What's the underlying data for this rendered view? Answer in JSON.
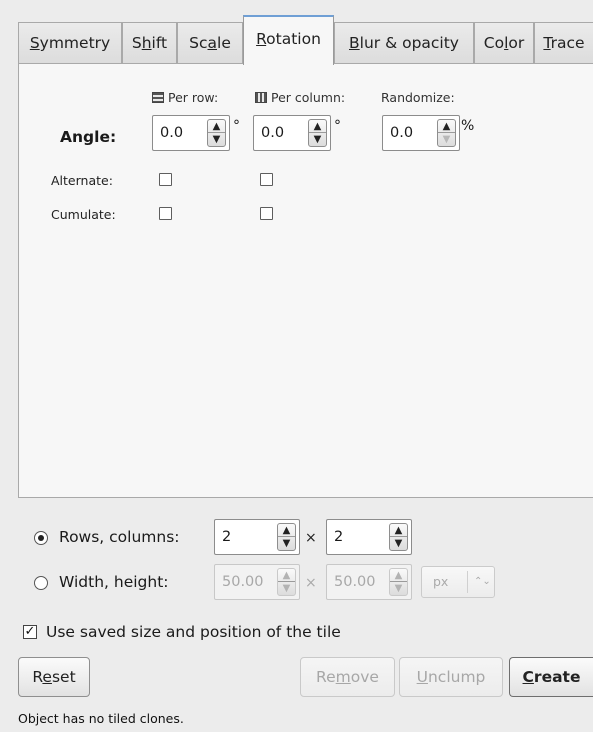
{
  "tabs": [
    {
      "pre": "",
      "key": "S",
      "post": "ymmetry"
    },
    {
      "pre": "S",
      "key": "h",
      "post": "ift"
    },
    {
      "pre": "Sc",
      "key": "a",
      "post": "le"
    },
    {
      "pre": "",
      "key": "R",
      "post": "otation"
    },
    {
      "pre": "",
      "key": "B",
      "post": "lur & opacity"
    },
    {
      "pre": "Co",
      "key": "l",
      "post": "or"
    },
    {
      "pre": "",
      "key": "T",
      "post": "race"
    }
  ],
  "rotation": {
    "col_per_row": "Per row:",
    "col_per_column": "Per column:",
    "col_randomize": "Randomize:",
    "angle_label": "Angle:",
    "angle_per_row": "0.0",
    "angle_per_column": "0.0",
    "angle_randomize": "0.0",
    "degree_unit": "°",
    "percent_unit": "%",
    "alternate_label": "Alternate:",
    "cumulate_label": "Cumulate:"
  },
  "tiling": {
    "rows_columns_label": "Rows, columns:",
    "rows": "2",
    "columns": "2",
    "times": "×",
    "width_height_label": "Width, height:",
    "width": "50.00",
    "height": "50.00",
    "unit": "px"
  },
  "use_saved_label": "Use saved size and position of the tile",
  "check_glyph": "✓",
  "buttons": {
    "reset": {
      "pre": "R",
      "key": "e",
      "post": "set"
    },
    "remove": {
      "pre": "Re",
      "key": "m",
      "post": "ove"
    },
    "unclump": {
      "pre": "",
      "key": "U",
      "post": "nclump"
    },
    "create": {
      "pre": "",
      "key": "C",
      "post": "reate"
    }
  },
  "status": "Object has no tiled clones.",
  "icons": {
    "per_row": "rows-icon",
    "per_column": "columns-icon",
    "spin_up": "▲",
    "spin_down": "▼",
    "dropdown": "⌃⌄"
  }
}
